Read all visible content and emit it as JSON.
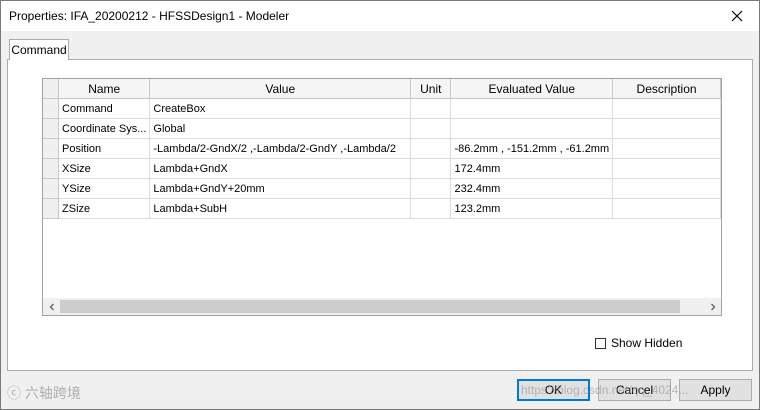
{
  "window": {
    "title": "Properties: IFA_20200212 - HFSSDesign1 - Modeler"
  },
  "tabs": [
    {
      "label": "Command"
    }
  ],
  "table": {
    "headers": [
      "Name",
      "Value",
      "Unit",
      "Evaluated Value",
      "Description"
    ],
    "rows": [
      {
        "name": "Command",
        "value": "CreateBox",
        "unit": "",
        "evaluated": "",
        "description": ""
      },
      {
        "name": "Coordinate Sys...",
        "value": "Global",
        "unit": "",
        "evaluated": "",
        "description": ""
      },
      {
        "name": "Position",
        "value": "-Lambda/2-GndX/2 ,-Lambda/2-GndY ,-Lambda/2",
        "unit": "",
        "evaluated": "-86.2mm , -151.2mm , -61.2mm",
        "description": ""
      },
      {
        "name": "XSize",
        "value": "Lambda+GndX",
        "unit": "",
        "evaluated": "172.4mm",
        "description": ""
      },
      {
        "name": "YSize",
        "value": "Lambda+GndY+20mm",
        "unit": "",
        "evaluated": "232.4mm",
        "description": ""
      },
      {
        "name": "ZSize",
        "value": "Lambda+SubH",
        "unit": "",
        "evaluated": "123.2mm",
        "description": ""
      }
    ]
  },
  "show_hidden": {
    "label": "Show Hidden",
    "checked": false
  },
  "buttons": {
    "ok": "OK",
    "cancel": "Cancel",
    "apply": "Apply"
  },
  "watermark": {
    "logo": "六轴跨境",
    "url": "https://blog.csdn.net/qq_4024..."
  }
}
